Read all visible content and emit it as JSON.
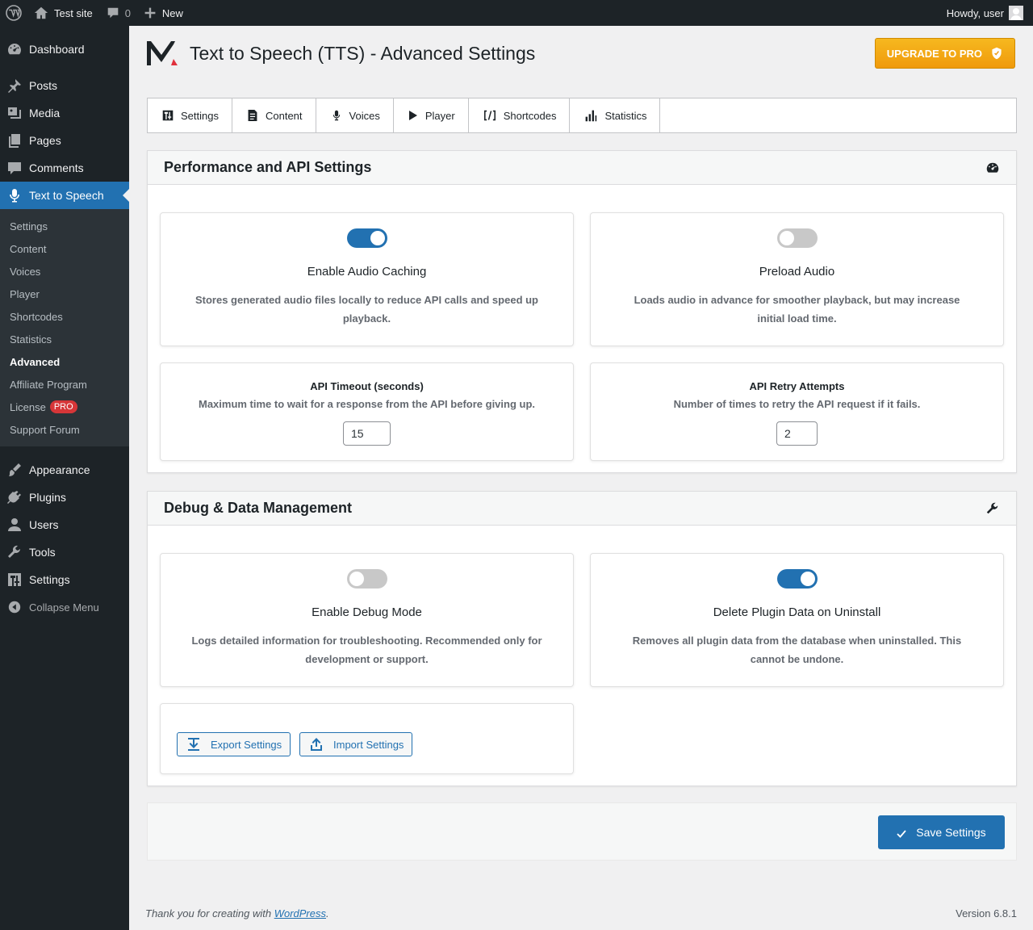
{
  "adminbar": {
    "site_name": "Test site",
    "comments_count": "0",
    "new_label": "New",
    "howdy": "Howdy, user"
  },
  "sidebar": {
    "items_top": [
      {
        "label": "Dashboard",
        "icon": "dashboard-icon"
      },
      {
        "label": "Posts",
        "icon": "pin-icon"
      },
      {
        "label": "Media",
        "icon": "media-icon"
      },
      {
        "label": "Pages",
        "icon": "pages-icon"
      },
      {
        "label": "Comments",
        "icon": "comment-icon"
      }
    ],
    "current": {
      "label": "Text to Speech",
      "icon": "microphone-icon"
    },
    "submenu": [
      "Settings",
      "Content",
      "Voices",
      "Player",
      "Shortcodes",
      "Statistics",
      "Advanced",
      "Affiliate Program",
      "License",
      "Support Forum"
    ],
    "license_badge": "PRO",
    "items_bottom": [
      {
        "label": "Appearance",
        "icon": "brush-icon"
      },
      {
        "label": "Plugins",
        "icon": "plugin-icon"
      },
      {
        "label": "Users",
        "icon": "users-icon"
      },
      {
        "label": "Tools",
        "icon": "wrench-icon"
      },
      {
        "label": "Settings",
        "icon": "settings-sliders-icon"
      }
    ],
    "collapse_label": "Collapse Menu"
  },
  "header": {
    "title": "Text to Speech (TTS) - Advanced Settings",
    "upgrade_label": "UPGRADE TO PRO"
  },
  "tabs": [
    {
      "label": "Settings",
      "icon": "settings-sliders-icon"
    },
    {
      "label": "Content",
      "icon": "document-icon"
    },
    {
      "label": "Voices",
      "icon": "microphone-icon"
    },
    {
      "label": "Player",
      "icon": "play-icon"
    },
    {
      "label": "Shortcodes",
      "icon": "shortcode-icon"
    },
    {
      "label": "Statistics",
      "icon": "bar-chart-icon"
    }
  ],
  "performance": {
    "title": "Performance and API Settings",
    "caching": {
      "title": "Enable Audio Caching",
      "desc": "Stores generated audio files locally to reduce API calls and speed up playback.",
      "enabled": true
    },
    "preload": {
      "title": "Preload Audio",
      "desc": "Loads audio in advance for smoother playback, but may increase initial load time.",
      "enabled": false
    },
    "timeout": {
      "title": "API Timeout (seconds)",
      "desc": "Maximum time to wait for a response from the API before giving up.",
      "value": "15"
    },
    "retry": {
      "title": "API Retry Attempts",
      "desc": "Number of times to retry the API request if it fails.",
      "value": "2"
    }
  },
  "debug": {
    "title": "Debug & Data Management",
    "debug_mode": {
      "title": "Enable Debug Mode",
      "desc": "Logs detailed information for troubleshooting. Recommended only for development or support.",
      "enabled": false
    },
    "delete_data": {
      "title": "Delete Plugin Data on Uninstall",
      "desc": "Removes all plugin data from the database when uninstalled. This cannot be undone.",
      "enabled": true
    },
    "export_label": "Export Settings",
    "import_label": "Import Settings"
  },
  "save_label": "Save Settings",
  "footer": {
    "thanks_prefix": "Thank you for creating with ",
    "wp_link": "WordPress",
    "thanks_suffix": ".",
    "version": "Version 6.8.1"
  },
  "colors": {
    "accent": "#2271b1",
    "sidebar_bg": "#1d2327",
    "upgrade": "#f0a10f"
  }
}
